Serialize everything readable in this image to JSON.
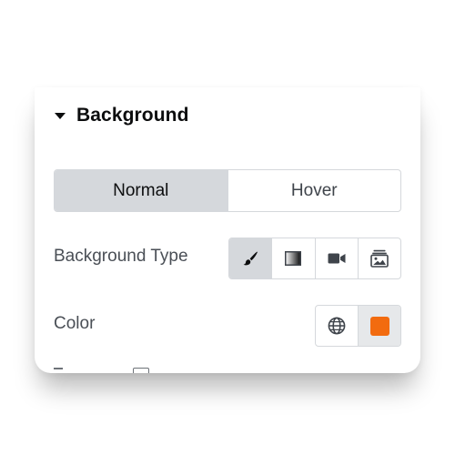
{
  "section": {
    "title": "Background",
    "caret_icon": "caret-down-icon"
  },
  "state_tabs": {
    "items": [
      {
        "label": "Normal",
        "active": true
      },
      {
        "label": "Hover",
        "active": false
      }
    ]
  },
  "background_type": {
    "label": "Background Type",
    "options": [
      {
        "icon": "brush-icon",
        "active": true
      },
      {
        "icon": "gradient-icon",
        "active": false
      },
      {
        "icon": "video-icon",
        "active": false
      },
      {
        "icon": "slideshow-icon",
        "active": false
      }
    ]
  },
  "color": {
    "label": "Color",
    "global_icon": "globe-icon",
    "value": "#f26b0f"
  },
  "colors": {
    "active_bg": "#d5d8dc",
    "border": "#d5d8dc",
    "text_dark": "#0c0d0e",
    "text_label": "#4a4f56"
  }
}
